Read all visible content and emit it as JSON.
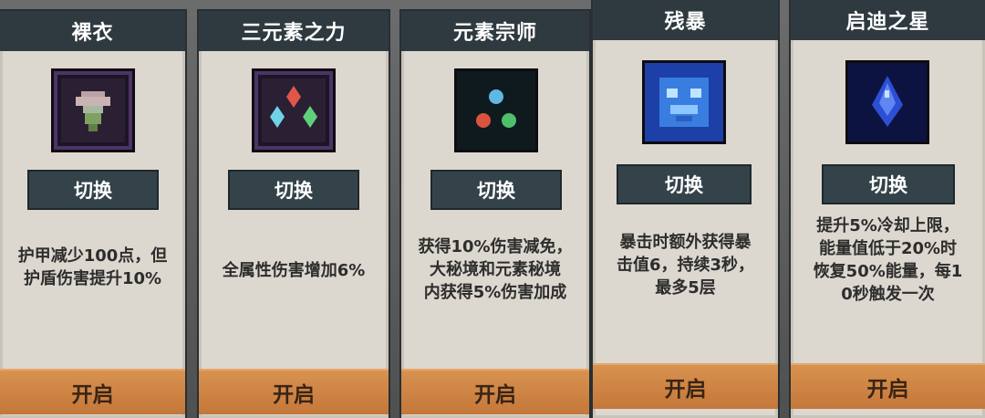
{
  "cards": [
    {
      "title": "裸衣",
      "icon": "flower-pot-icon",
      "switch_label": "切换",
      "description": "护甲减少100点，但\n护盾伤害提升10%",
      "open_label": "开启"
    },
    {
      "title": "三元素之力",
      "icon": "three-element-crystals-icon",
      "switch_label": "切换",
      "description": "全属性伤害增加6%",
      "open_label": "开启"
    },
    {
      "title": "元素宗师",
      "icon": "element-orbs-icon",
      "switch_label": "切换",
      "description": "获得10%伤害减免，\n大秘境和元素秘境\n内获得5%伤害加成",
      "open_label": "开启"
    },
    {
      "title": "残暴",
      "icon": "blue-beast-icon",
      "switch_label": "切换",
      "description": "暴击时额外获得暴\n击值6，持续3秒，\n最多5层",
      "open_label": "开启"
    },
    {
      "title": "启迪之星",
      "icon": "blue-star-gem-icon",
      "switch_label": "切换",
      "description": "提升5%冷却上限，\n能量值低于20%时\n恢复50%能量，每1\n0秒触发一次",
      "open_label": "开启"
    }
  ],
  "colors": {
    "title_bar": "#2f3a40",
    "card_body": "#dcd8cf",
    "switch_button": "#34434a",
    "open_button": "#c4773a"
  }
}
